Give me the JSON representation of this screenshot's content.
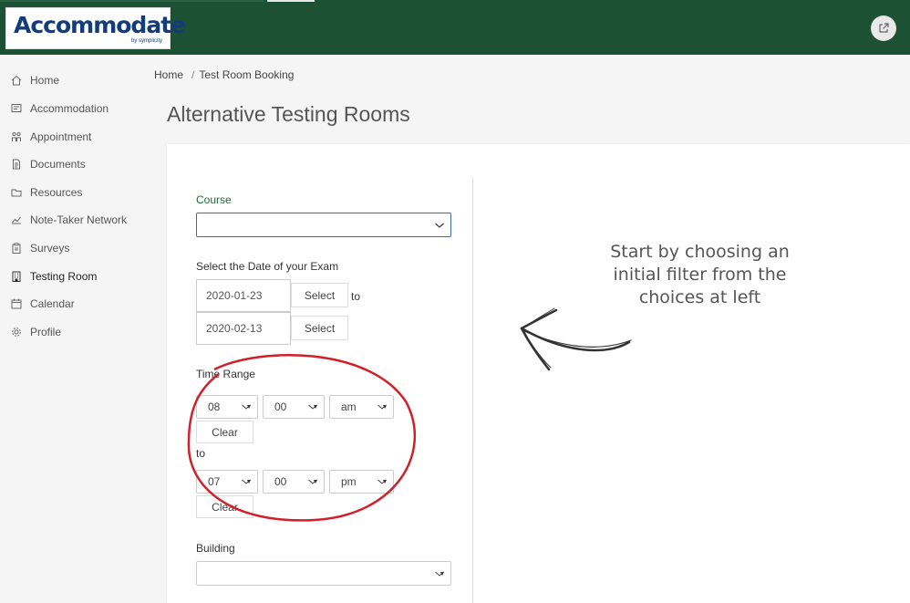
{
  "app": {
    "logo_text": "Accommodate",
    "logo_sub": "by symplicity",
    "brand_color": "#1d5134",
    "accent_color": "#1d6b3a",
    "external_link_icon": "external-link-icon"
  },
  "sidebar": {
    "items": [
      {
        "label": "Home",
        "icon": "home-icon"
      },
      {
        "label": "Accommodation",
        "icon": "message-icon"
      },
      {
        "label": "Appointment",
        "icon": "people-icon"
      },
      {
        "label": "Documents",
        "icon": "document-icon"
      },
      {
        "label": "Resources",
        "icon": "folder-icon"
      },
      {
        "label": "Note-Taker Network",
        "icon": "chart-icon"
      },
      {
        "label": "Surveys",
        "icon": "clipboard-icon"
      },
      {
        "label": "Testing Room",
        "icon": "building-icon",
        "active": true
      },
      {
        "label": "Calendar",
        "icon": "calendar-icon"
      },
      {
        "label": "Profile",
        "icon": "gear-icon"
      }
    ]
  },
  "breadcrumb": {
    "home": "Home",
    "separator": "/",
    "current": "Test Room Booking"
  },
  "page": {
    "title": "Alternative Testing Rooms"
  },
  "form": {
    "course_label": "Course",
    "course_value": "",
    "date_label": "Select the Date of your Exam",
    "date_from": "2020-01-23",
    "date_to": "2020-02-13",
    "select_label": "Select",
    "to_label": "to",
    "time_label": "Time Range",
    "start_hour": "08",
    "start_minute": "00",
    "start_ampm": "am",
    "end_hour": "07",
    "end_minute": "00",
    "end_ampm": "pm",
    "clear_label": "Clear",
    "building_label": "Building",
    "building_value": ""
  },
  "hint": {
    "text": "Start by choosing an initial filter from the choices at left"
  },
  "annotation": {
    "circle_color": "#d0202a"
  }
}
